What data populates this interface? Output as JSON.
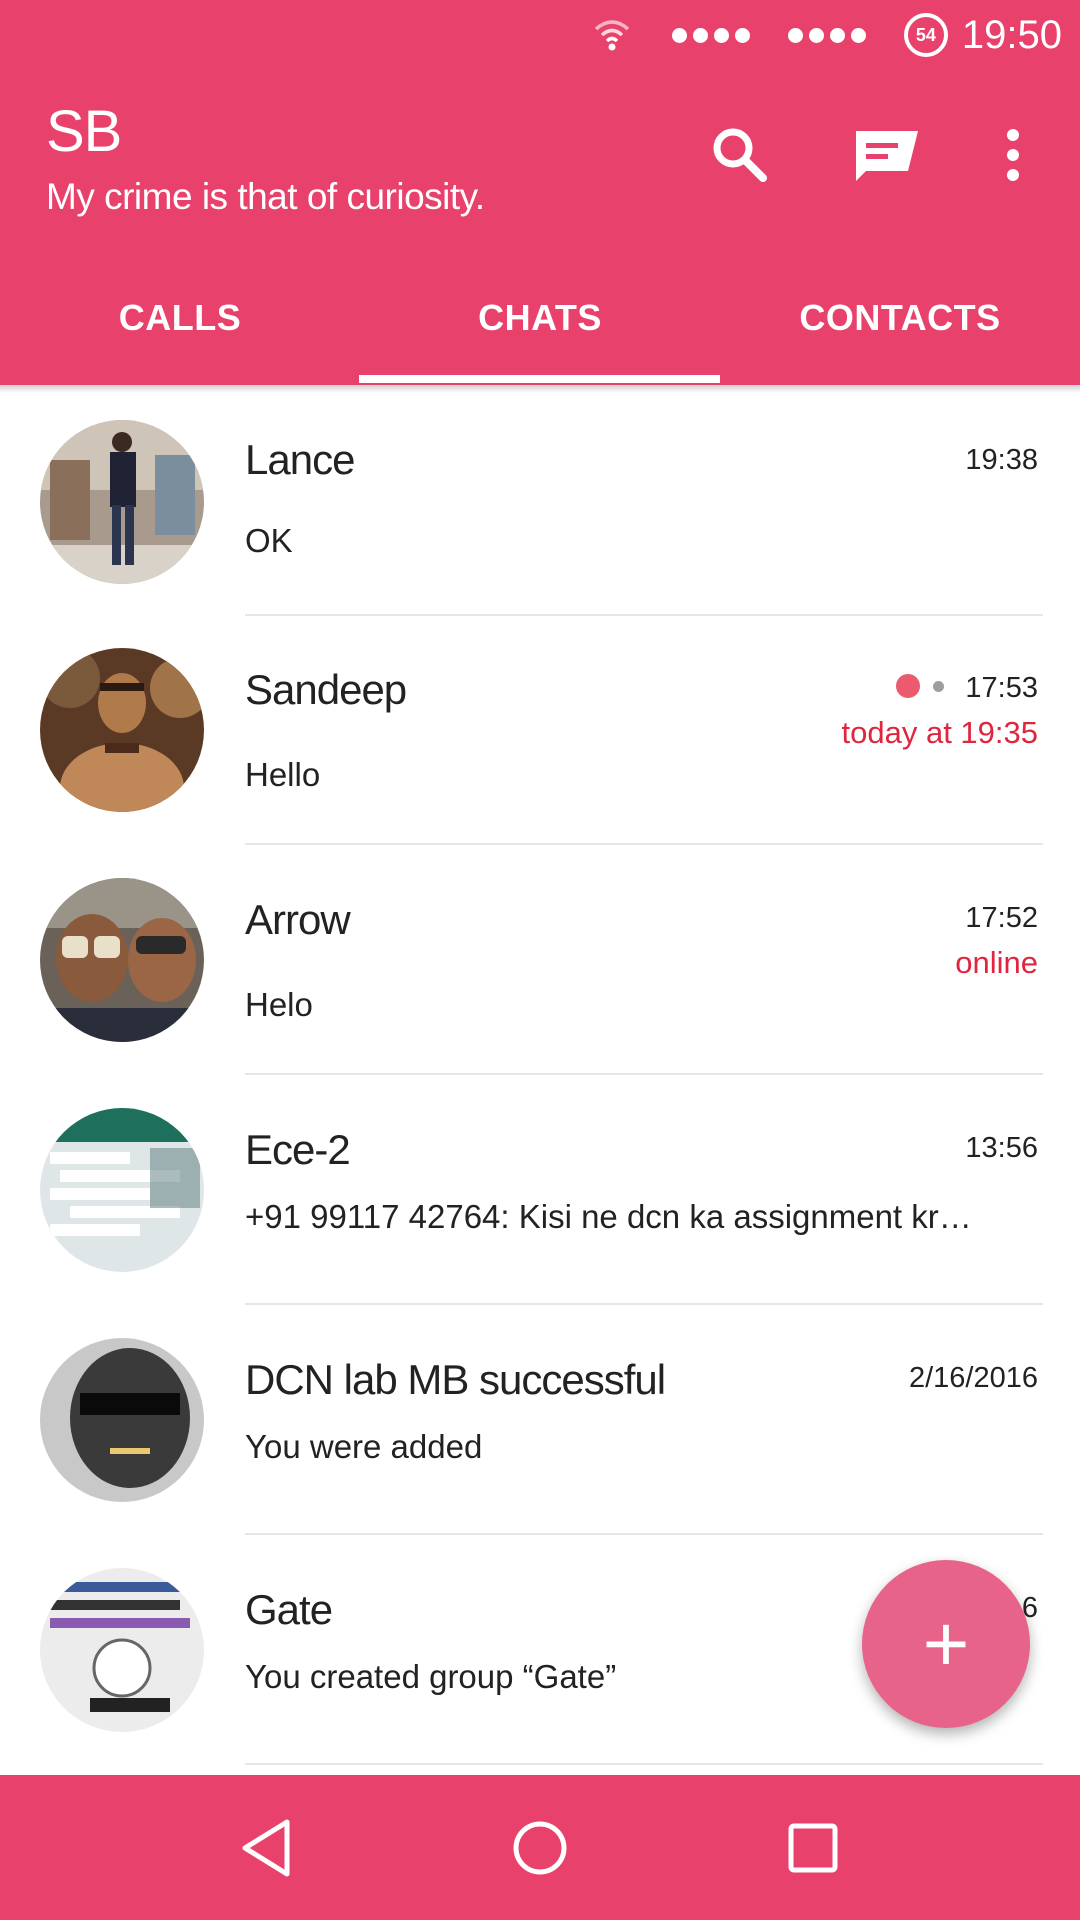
{
  "statusbar": {
    "battery_level": "54",
    "time": "19:50"
  },
  "header": {
    "title": "SB",
    "subtitle": "My crime is that of curiosity."
  },
  "tabs": [
    {
      "label": "CALLS"
    },
    {
      "label": "CHATS"
    },
    {
      "label": "CONTACTS"
    }
  ],
  "active_tab": "CHATS",
  "chats": [
    {
      "name": "Lance",
      "time": "19:38",
      "status": "",
      "message": "OK"
    },
    {
      "name": "Sandeep",
      "time": "17:53",
      "status": "today at 19:35",
      "message": "Hello"
    },
    {
      "name": "Arrow",
      "time": "17:52",
      "status": "online",
      "message": "Helo"
    },
    {
      "name": "Ece-2",
      "time": "13:56",
      "status": "",
      "message": "+91 99117 42764: Kisi ne dcn ka assignment kr…"
    },
    {
      "name": "DCN lab MB successful",
      "time": "2/16/2016",
      "status": "",
      "message": "You were added"
    },
    {
      "name": "Gate",
      "time": "6",
      "status": "",
      "message": "You created group “Gate”"
    }
  ],
  "fab": {
    "label": "+"
  },
  "colors": {
    "primary": "#e8416b",
    "accent": "#e8638a",
    "status_red": "#e0263f"
  }
}
